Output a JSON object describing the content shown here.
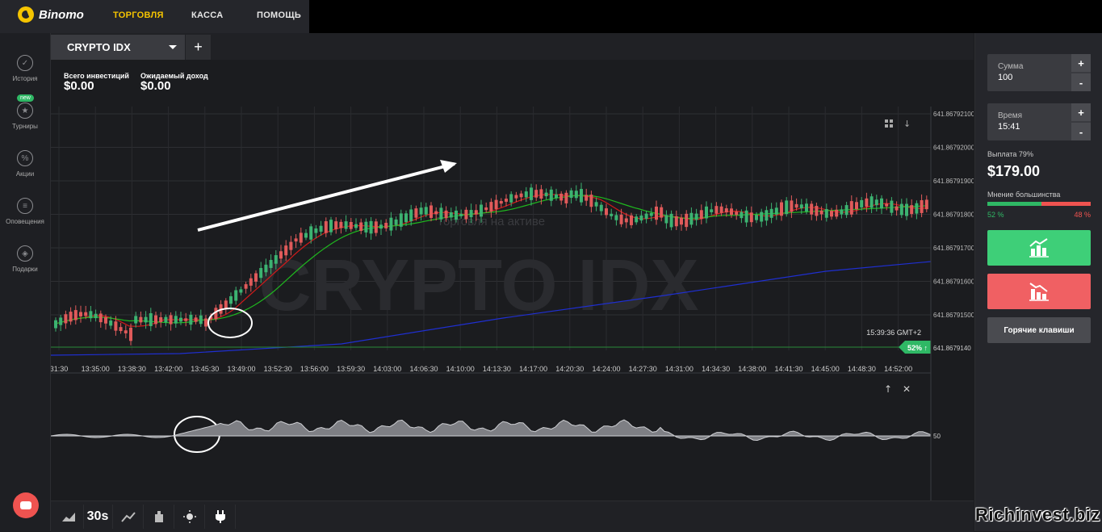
{
  "header": {
    "brand": "Binomo",
    "nav": [
      {
        "label": "ТОРГОВЛЯ",
        "active": true
      },
      {
        "label": "КАССА",
        "active": false
      },
      {
        "label": "ПОМОЩЬ",
        "active": false
      }
    ],
    "accent_color": "#f5c400"
  },
  "sidebar": {
    "items": [
      {
        "label": "История",
        "icon": "check-circle-icon"
      },
      {
        "label": "Турниры",
        "icon": "trophy-icon"
      },
      {
        "label": "Акции",
        "icon": "percent-icon"
      },
      {
        "label": "Оповещения",
        "icon": "list-icon"
      },
      {
        "label": "Подарки",
        "icon": "gift-icon"
      }
    ],
    "new_badge": "new"
  },
  "asset_tab": {
    "name": "CRYPTO IDX",
    "add_label": "+"
  },
  "investments": {
    "total_label": "Всего инвестиций",
    "total_value": "$0.00",
    "expected_label": "Ожидаемый доход",
    "expected_value": "$0.00"
  },
  "chart": {
    "watermark": "CRYPTO IDX",
    "overlay_text": "Торговля на активе",
    "clock": "15:39:36 GMT+2",
    "current_pct": "52% ↑",
    "current_price": "641.8679140",
    "y_labels": [
      "641.86792100",
      "641.86792000",
      "641.86791900",
      "641.86791800",
      "641.86791700",
      "641.86791600",
      "641.86791500"
    ],
    "x_labels": [
      "31:30",
      "13:35:00",
      "13:38:30",
      "13:42:00",
      "13:45:30",
      "13:49:00",
      "13:52:30",
      "13:56:00",
      "13:59:30",
      "14:03:00",
      "14:06:30",
      "14:10:00",
      "14:13:30",
      "14:17:00",
      "14:20:30",
      "14:24:00",
      "14:27:30",
      "14:31:00",
      "14:34:30",
      "14:38:00",
      "14:41:30",
      "14:45:00",
      "14:48:30",
      "14:52:00"
    ],
    "oscillator_level": "50",
    "colors": {
      "up": "#3cb371",
      "down": "#e05a5a",
      "ma_fast": "#d11a1a",
      "ma_slow": "#1fb81f",
      "ma_long": "#1f2fd1",
      "price_line": "#2a8a3a"
    }
  },
  "toolbar": {
    "items": [
      {
        "icon": "area-chart-icon"
      },
      {
        "icon": "timeframe-icon",
        "label": "30s"
      },
      {
        "icon": "drawing-tools-icon"
      },
      {
        "icon": "indicators-icon"
      },
      {
        "icon": "theme-brightness-icon"
      },
      {
        "icon": "plug-icon"
      }
    ]
  },
  "trade_panel": {
    "amount_label": "Сумма",
    "amount_value": "100",
    "time_label": "Время",
    "time_value": "15:41",
    "plus": "+",
    "minus": "-",
    "payout_label": "Выплата 79%",
    "payout_value": "$179.00",
    "majority_label": "Мнение большинства",
    "majority_up_pct": "52 %",
    "majority_down_pct": "48 %",
    "majority_up_fraction": 0.52,
    "hotkeys_label": "Горячие клавиши",
    "up_color": "#3ecf78",
    "down_color": "#f06063"
  },
  "watermark_site": "Richinvest.biz"
}
